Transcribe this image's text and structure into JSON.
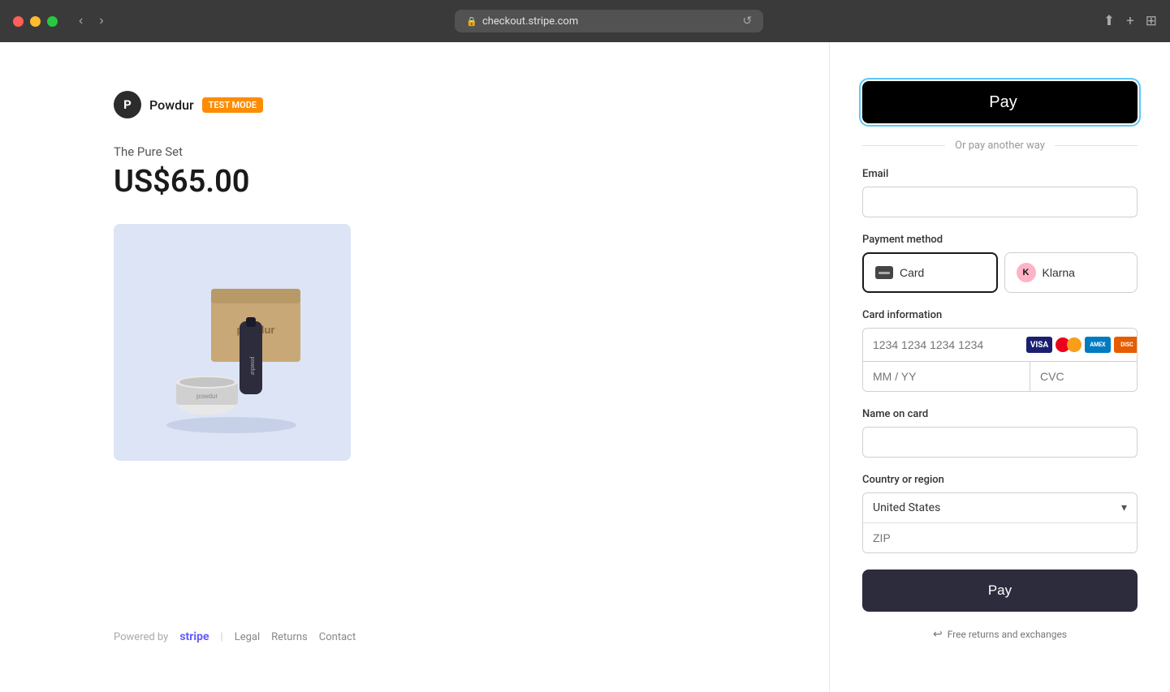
{
  "browser": {
    "url": "checkout.stripe.com",
    "lock_icon": "🔒",
    "reload_icon": "↺"
  },
  "brand": {
    "initial": "P",
    "name": "Powdur",
    "badge": "TEST MODE"
  },
  "product": {
    "name": "The Pure Set",
    "price": "US$65.00"
  },
  "apple_pay": {
    "label": " Pay",
    "apple_symbol": ""
  },
  "divider": {
    "text": "Or pay another way"
  },
  "email_field": {
    "label": "Email",
    "placeholder": ""
  },
  "payment_method": {
    "label": "Payment method",
    "tabs": [
      {
        "id": "card",
        "label": "Card",
        "active": true
      },
      {
        "id": "klarna",
        "label": "Klarna",
        "active": false
      }
    ]
  },
  "card_information": {
    "label": "Card information",
    "card_number_placeholder": "1234 1234 1234 1234",
    "expiry_placeholder": "MM / YY",
    "cvc_placeholder": "CVC"
  },
  "name_on_card": {
    "label": "Name on card",
    "placeholder": ""
  },
  "country_region": {
    "label": "Country or region",
    "selected": "United States",
    "zip_placeholder": "ZIP"
  },
  "pay_button": {
    "label": "Pay"
  },
  "free_returns": {
    "text": "Free returns and exchanges"
  },
  "footer": {
    "powered_by": "Powered by",
    "stripe": "stripe",
    "links": [
      "Legal",
      "Returns",
      "Contact"
    ]
  }
}
